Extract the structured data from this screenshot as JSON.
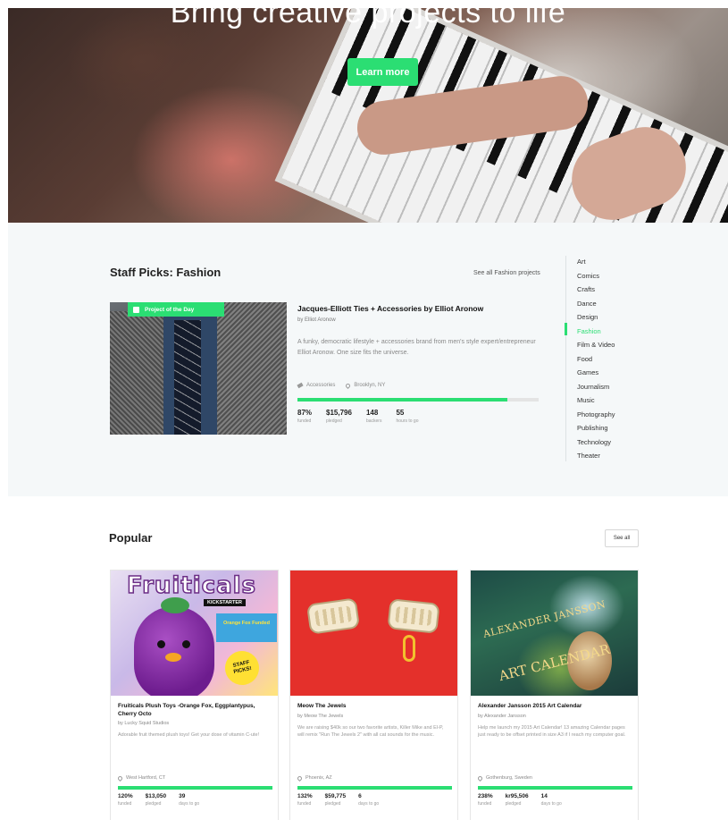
{
  "hero": {
    "title": "Bring creative projects to life",
    "button_label": "Learn more"
  },
  "staff_picks": {
    "title": "Staff Picks: Fashion",
    "see_all_label": "See all Fashion projects",
    "badge_label": "Project of the Day",
    "project": {
      "title": "Jacques-Elliott Ties + Accessories by Elliot Aronow",
      "by": "by Elliot Aronow",
      "description": "A funky, democratic lifestyle + accessories brand from men's style expert/entrepreneur Elliot Aronow. One size fits the universe.",
      "category": "Accessories",
      "location": "Brooklyn, NY",
      "funded_percent": 87,
      "stats": [
        {
          "value": "87%",
          "label": "funded"
        },
        {
          "value": "$15,796",
          "label": "pledged"
        },
        {
          "value": "148",
          "label": "backers"
        },
        {
          "value": "55",
          "label": "hours to go"
        }
      ]
    },
    "categories": [
      "Art",
      "Comics",
      "Crafts",
      "Dance",
      "Design",
      "Fashion",
      "Film & Video",
      "Food",
      "Games",
      "Journalism",
      "Music",
      "Photography",
      "Publishing",
      "Technology",
      "Theater"
    ],
    "active_category": "Fashion"
  },
  "popular": {
    "title": "Popular",
    "see_all_label": "See all",
    "image_text": {
      "card1_word": "Fruiticals",
      "card1_brand": "KICKSTARTER",
      "card1_funded": "Orange Fox Funded",
      "card1_staff": "STAFF PICKS!",
      "card3_line1": "ALEXANDER JANSSON",
      "card3_line2": "ART CALENDAR"
    },
    "cards": [
      {
        "title": "Fruiticals Plush Toys -Orange Fox, Eggplantypus, Cherry Octo",
        "by": "by Lucky Squid Studios",
        "description": "Adorable fruit themed plush toys! Get your dose of vitamin C-ute!",
        "location": "West Hartford, CT",
        "funded_percent": 100,
        "stats": [
          {
            "value": "120%",
            "label": "funded"
          },
          {
            "value": "$13,050",
            "label": "pledged"
          },
          {
            "value": "39",
            "label": "days to go"
          }
        ]
      },
      {
        "title": "Meow The Jewels",
        "by": "by Meow The Jewels",
        "description": "We are raising $40k so our two favorite artists, Killer Mike and El-P, will remix \"Run The Jewels 2\" with all cat sounds for the music.",
        "location": "Phoenix, AZ",
        "funded_percent": 100,
        "stats": [
          {
            "value": "132%",
            "label": "funded"
          },
          {
            "value": "$59,775",
            "label": "pledged"
          },
          {
            "value": "6",
            "label": "days to go"
          }
        ]
      },
      {
        "title": "Alexander Jansson 2015 Art Calendar",
        "by": "by Alexander Jansson",
        "description": "Help me launch my 2015 Art Calendar! 13 amazing Calendar pages just ready to be offset printed in size A3 if I reach my computer goal.",
        "location": "Gothenburg, Sweden",
        "funded_percent": 100,
        "stats": [
          {
            "value": "238%",
            "label": "funded"
          },
          {
            "value": "kr95,506",
            "label": "pledged"
          },
          {
            "value": "14",
            "label": "days to go"
          }
        ]
      }
    ]
  },
  "colors": {
    "accent_green": "#2bde73",
    "staff_bg": "#f5f8f9"
  }
}
